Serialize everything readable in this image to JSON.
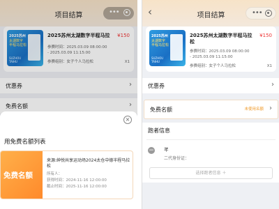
{
  "left": {
    "header": {
      "title": "项目结算"
    },
    "order": {
      "title_line1": "2025苏州太湖数字半程马拉",
      "price": "¥150",
      "time_line1": "参赛时间：2025.03.09 08:00:00",
      "time_line2": "- 2025.03.09 11:15:00",
      "group": "参赛组别：女子个人马拉松",
      "qty": "X1",
      "thumb": {
        "t1": "2025苏州",
        "t2": "太湖数字\n半程马拉松",
        "t3": "SUZHOU\nTAIHU"
      }
    },
    "rows": {
      "coupon": "优惠券",
      "free_quota": "免费名额"
    },
    "sheet": {
      "title": "用免费名额列表",
      "badge": "免费名额",
      "source": "来源:绅悦共享运动场2024太仓中德半程马拉松",
      "owner": "所有人：",
      "get_time": "获得时间：2024-11-16 12:00:00",
      "expire_time": "截止时间：2025-11-16 12:00:00"
    }
  },
  "right": {
    "header": {
      "title": "项目结算"
    },
    "order": {
      "title_line1": "2025苏州太湖数字半程马拉",
      "title_line2": "松",
      "price": "¥150",
      "time_line1": "参赛时间：2025.03.09 08:00:00",
      "time_line2": "- 2025.03.09 11:15:00",
      "group": "参赛组别：女子个人马拉松",
      "qty": "X1",
      "thumb": {
        "t1": "2025苏州",
        "t2": "太湖数字\n半程马拉松",
        "t3": "SUZHOU\nTAIHU"
      }
    },
    "rows": {
      "coupon": "优惠券",
      "free_quota": "免费名额",
      "free_quota_hint": "未使用名额",
      "runner_info": "跑者信息"
    },
    "runner": {
      "name": "芊",
      "id": "二代身份证："
    },
    "select_button": "选择跑者信息 ＋"
  },
  "icons": {
    "back": "chevron-left-icon",
    "more": "more-dots-icon",
    "target": "target-icon",
    "close": "close-icon",
    "chevron": "chevron-right-icon",
    "minus": "minus-circle-icon"
  },
  "colors": {
    "accent": "#ff8a2b",
    "price": "#e33333",
    "header": "#f7e3c8"
  }
}
